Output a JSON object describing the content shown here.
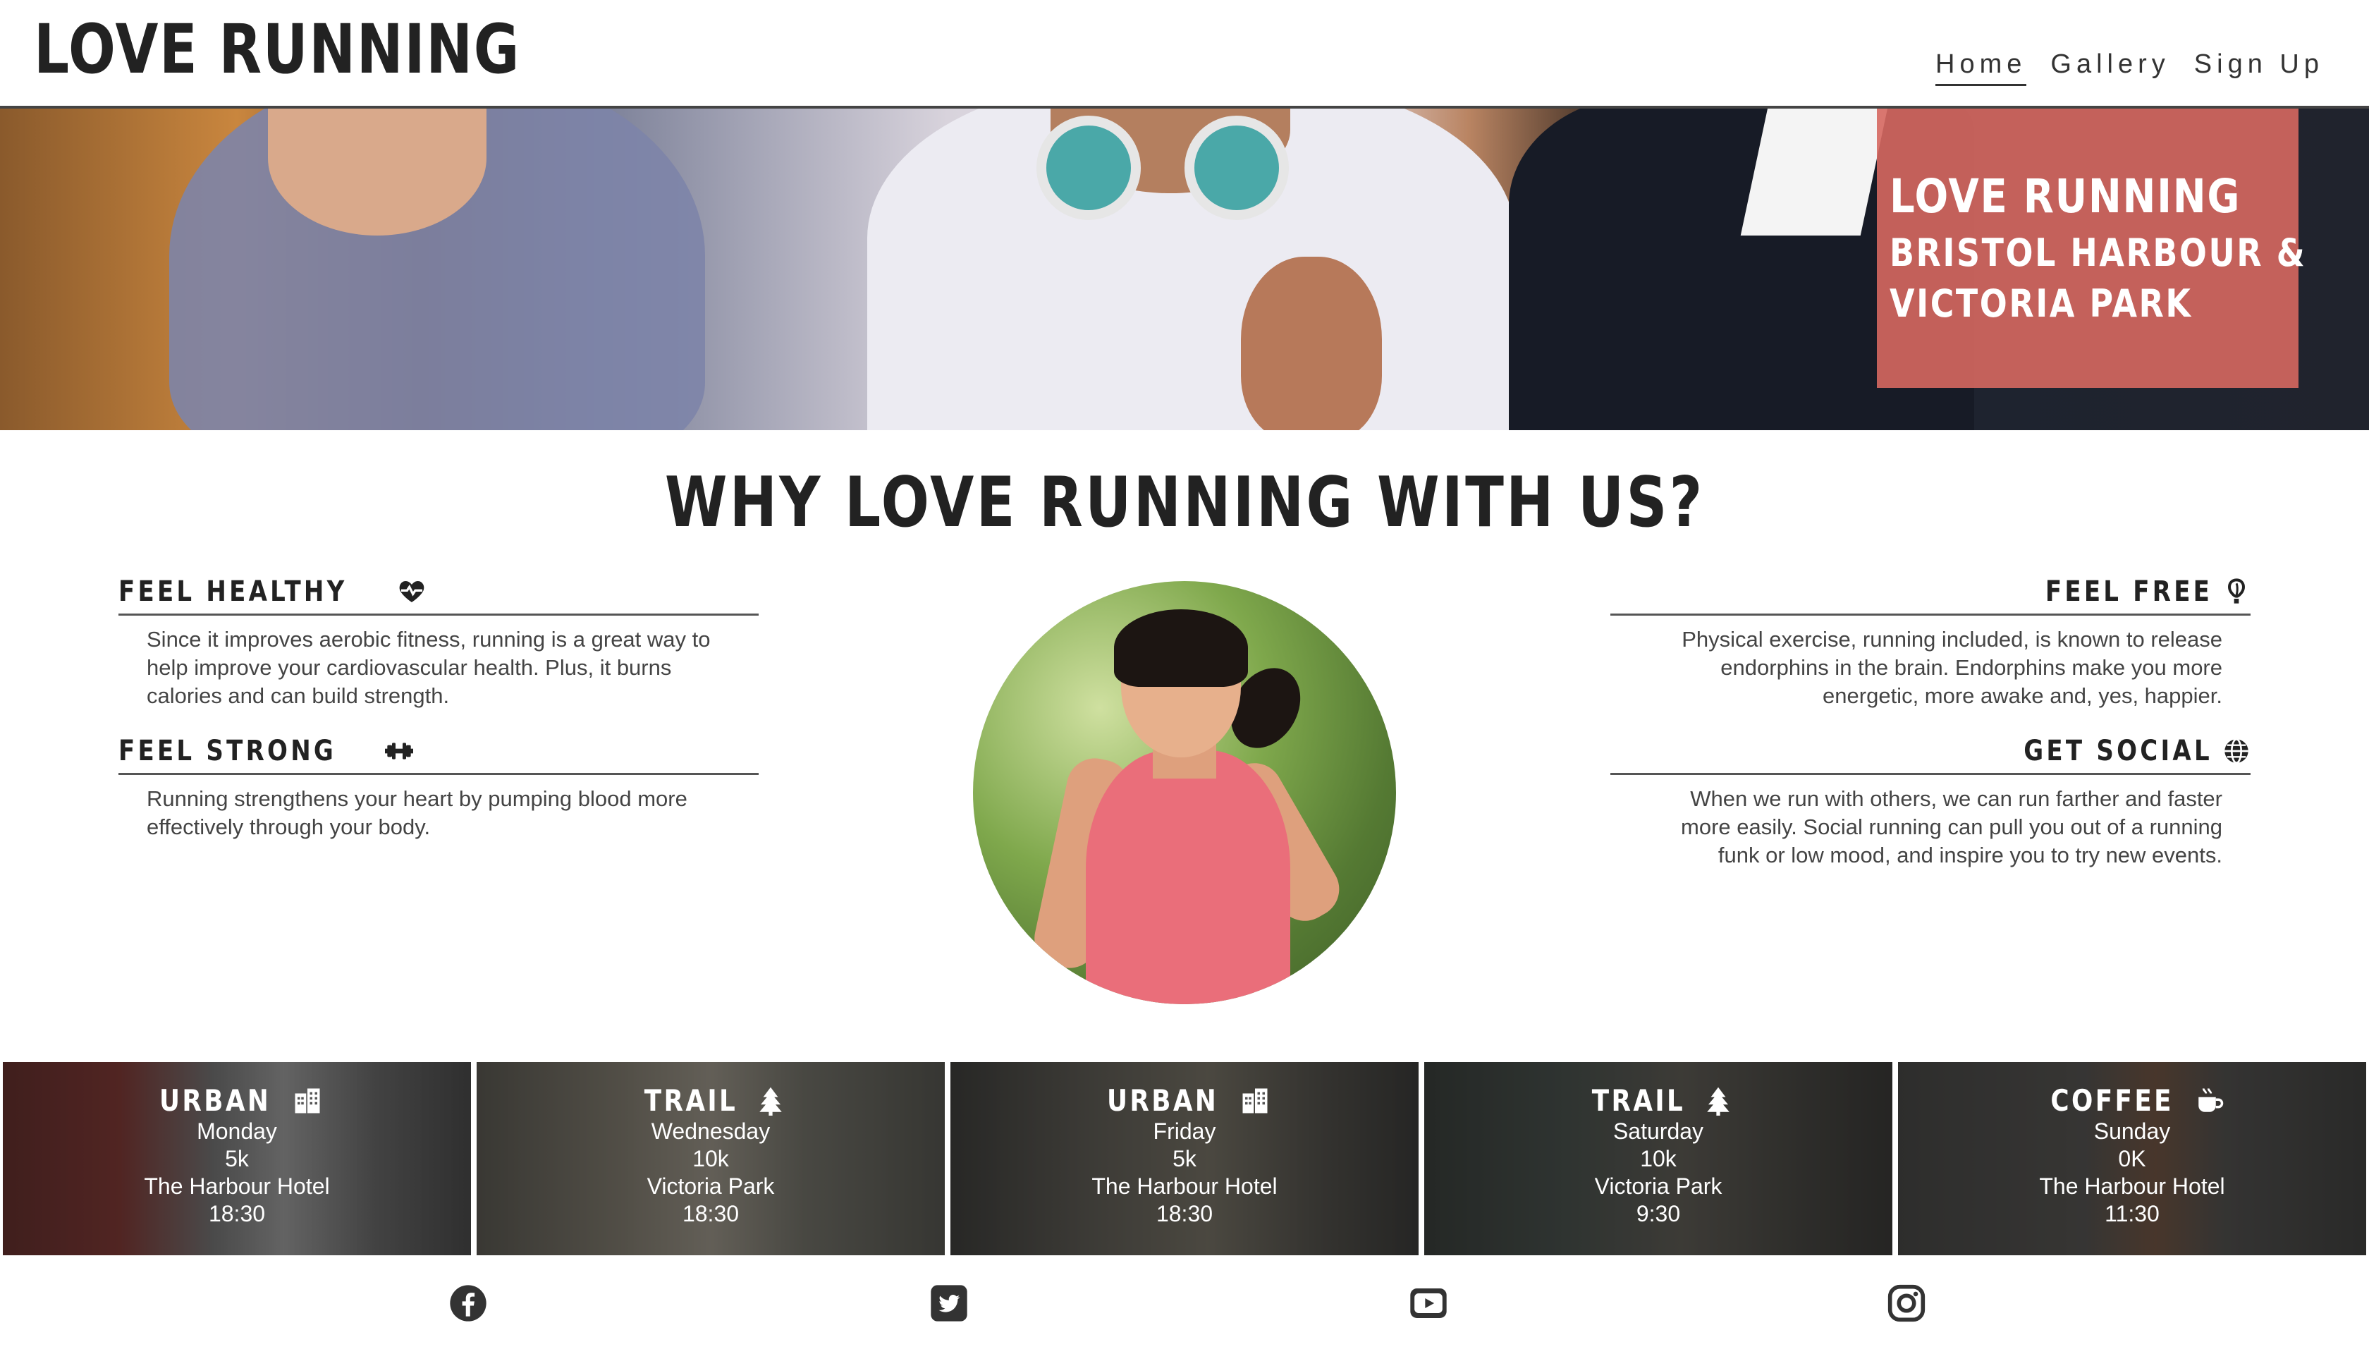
{
  "header": {
    "logo": "LOVE RUNNING",
    "nav": [
      {
        "label": "Home",
        "active": true
      },
      {
        "label": "Gallery",
        "active": false
      },
      {
        "label": "Sign Up",
        "active": false
      }
    ]
  },
  "hero": {
    "title": "LOVE RUNNING",
    "subtitle_line1": "BRISTOL HARBOUR &",
    "subtitle_line2": "VICTORIA PARK",
    "box_color": "#d66860"
  },
  "why": {
    "title": "WHY LOVE RUNNING WITH US?",
    "features": [
      {
        "heading": "FEEL HEALTHY",
        "icon": "heartbeat-icon",
        "text": "Since it improves aerobic fitness, running is a great way to help improve your cardiovascular health. Plus, it burns calories and can build strength."
      },
      {
        "heading": "FEEL STRONG",
        "icon": "dumbbell-icon",
        "text": "Running strengthens your heart by pumping blood more effectively through your body."
      },
      {
        "heading": "FEEL FREE",
        "icon": "balloon-icon",
        "text": "Physical exercise, running included, is known to release endorphins in the brain. Endorphins make you more energetic, more awake and, yes, happier."
      },
      {
        "heading": "GET SOCIAL",
        "icon": "globe-icon",
        "text": "When we run with others, we can run farther and faster more easily. Social running can pull you out of a running funk or low mood, and inspire you to try new events."
      }
    ]
  },
  "runs": [
    {
      "type": "URBAN",
      "icon": "building-icon",
      "day": "Monday",
      "distance": "5k",
      "location": "The Harbour Hotel",
      "time": "18:30"
    },
    {
      "type": "TRAIL",
      "icon": "tree-icon",
      "day": "Wednesday",
      "distance": "10k",
      "location": "Victoria Park",
      "time": "18:30"
    },
    {
      "type": "URBAN",
      "icon": "building-icon",
      "day": "Friday",
      "distance": "5k",
      "location": "The Harbour Hotel",
      "time": "18:30"
    },
    {
      "type": "TRAIL",
      "icon": "tree-icon",
      "day": "Saturday",
      "distance": "10k",
      "location": "Victoria Park",
      "time": "9:30"
    },
    {
      "type": "COFFEE",
      "icon": "coffee-icon",
      "day": "Sunday",
      "distance": "0K",
      "location": "The Harbour Hotel",
      "time": "11:30"
    }
  ],
  "footer": {
    "social": [
      "facebook-icon",
      "twitter-icon",
      "youtube-icon",
      "instagram-icon"
    ]
  }
}
